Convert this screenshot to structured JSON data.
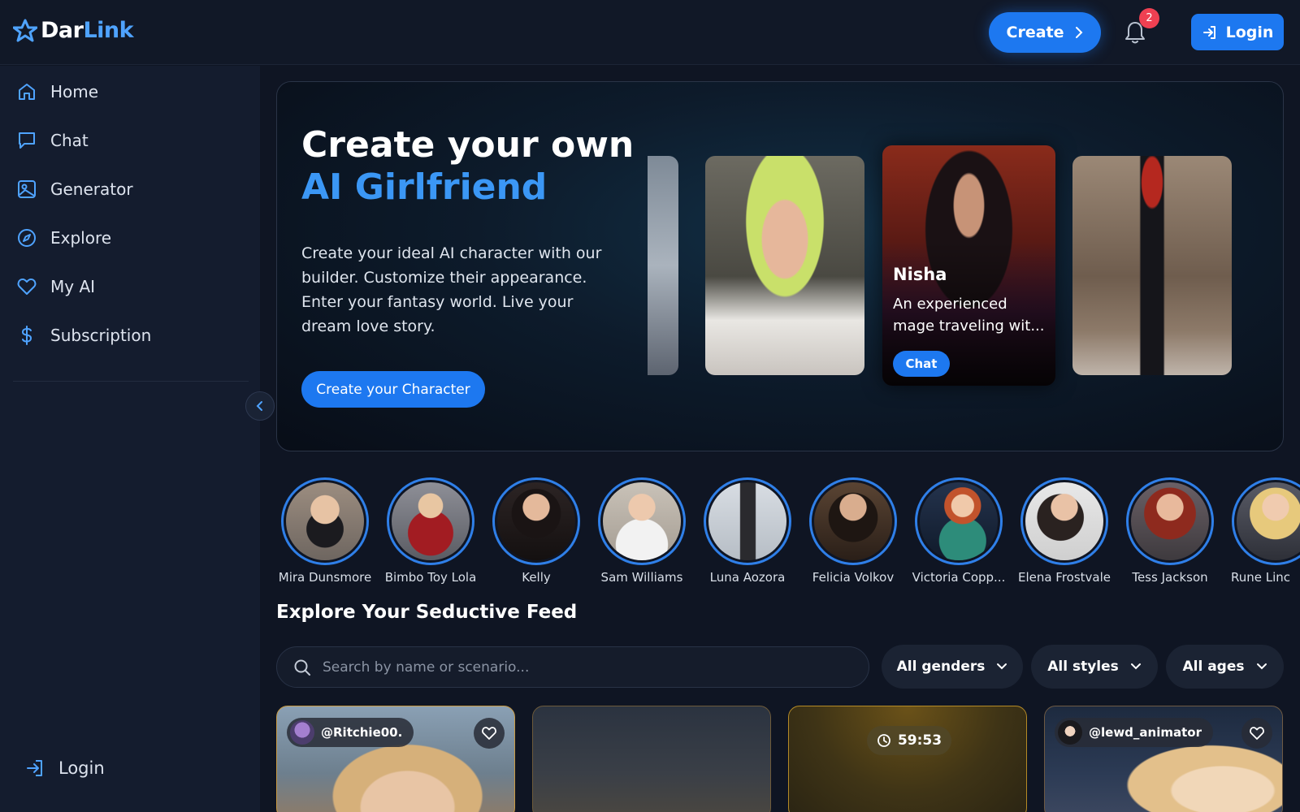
{
  "header": {
    "logo": {
      "part1": "Dar",
      "part2": "Link"
    },
    "create_label": "Create",
    "notification_count": "2",
    "login_label": "Login"
  },
  "sidebar": {
    "items": [
      {
        "label": "Home",
        "icon": "home-icon"
      },
      {
        "label": "Chat",
        "icon": "chat-icon"
      },
      {
        "label": "Generator",
        "icon": "image-icon"
      },
      {
        "label": "Explore",
        "icon": "compass-icon"
      },
      {
        "label": "My AI",
        "icon": "heart-icon"
      },
      {
        "label": "Subscription",
        "icon": "dollar-icon"
      }
    ],
    "login_label": "Login"
  },
  "hero": {
    "title_line1": "Create your own",
    "title_line2": "AI Girlfriend",
    "description": "Create your ideal AI character with our builder. Customize their appearance. Enter your fantasy world. Live your dream love story.",
    "cta_label": "Create your Character",
    "featured": {
      "name": "Nisha",
      "description": "An experienced mage traveling wit...",
      "chat_label": "Chat"
    }
  },
  "characters": [
    {
      "name": "Mira Dunsmore"
    },
    {
      "name": "Bimbo Toy Lola"
    },
    {
      "name": "Kelly"
    },
    {
      "name": "Sam Williams"
    },
    {
      "name": "Luna Aozora"
    },
    {
      "name": "Felicia Volkov"
    },
    {
      "name": "Victoria Copp..."
    },
    {
      "name": "Elena Frostvale"
    },
    {
      "name": "Tess Jackson"
    },
    {
      "name": "Rune Linc"
    }
  ],
  "feed": {
    "title": "Explore Your Seductive Feed",
    "search_placeholder": "Search by name or scenario...",
    "filters": {
      "gender": "All genders",
      "style": "All styles",
      "age": "All ages"
    },
    "cards": [
      {
        "user": "@Ritchie00."
      },
      {
        "user": ""
      },
      {
        "timer": "59:53"
      },
      {
        "user": "@lewd_animator"
      }
    ]
  },
  "colors": {
    "accent": "#1d78f0",
    "accent_light": "#3b97f5",
    "background": "#0f1523",
    "sidebar": "#141c2e",
    "badge": "#ef4052"
  }
}
